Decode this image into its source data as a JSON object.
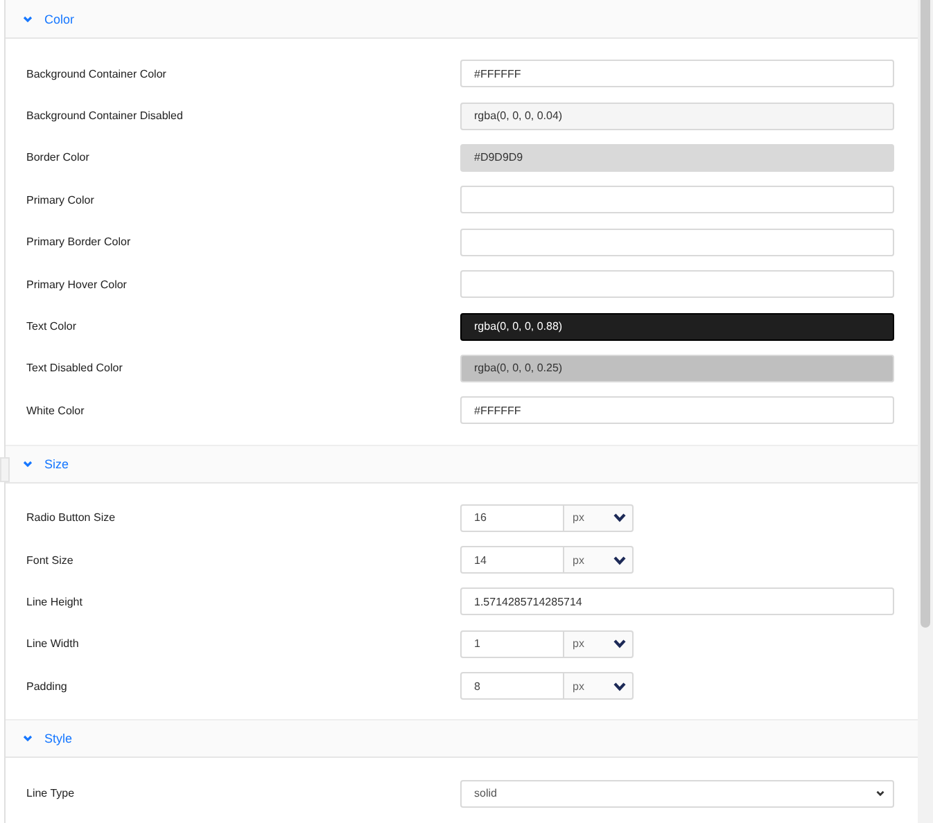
{
  "sections": [
    {
      "title": "Color",
      "expanded": true,
      "rows": [
        {
          "label": "Background Container Color",
          "kind": "color",
          "value": "#FFFFFF",
          "color": "#ffffff"
        },
        {
          "label": "Background Container Disabled",
          "kind": "color",
          "value": "rgba(0, 0, 0, 0.04)",
          "color": "#f5f5f5"
        },
        {
          "label": "Border Color",
          "kind": "color",
          "value": "#D9D9D9",
          "color": "#d9d9d9"
        },
        {
          "label": "Primary Color",
          "kind": "color",
          "color": "#ffffff"
        },
        {
          "label": "Primary Border Color",
          "kind": "color",
          "color": "#ffffff"
        },
        {
          "label": "Primary Hover Color",
          "kind": "color",
          "color": "#ffffff"
        },
        {
          "label": "Text Color",
          "kind": "color",
          "value": "rgba(0, 0, 0, 0.88)",
          "color": "#1f1f1f"
        },
        {
          "label": "Text Disabled Color",
          "kind": "color",
          "value": "rgba(0, 0, 0, 0.25)",
          "color": "#bfbfbf"
        },
        {
          "label": "White Color",
          "kind": "color",
          "value": "#FFFFFF",
          "color": "#ffffff"
        }
      ]
    },
    {
      "title": "Size",
      "expanded": true,
      "rows": [
        {
          "label": "Radio Button Size",
          "kind": "unit",
          "value": "16",
          "unit": "px"
        },
        {
          "label": "Font Size",
          "kind": "unit",
          "value": "14",
          "unit": "px"
        },
        {
          "label": "Line Height",
          "kind": "text",
          "value": "1.5714285714285714"
        },
        {
          "label": "Line Width",
          "kind": "unit",
          "value": "1",
          "unit": "px"
        },
        {
          "label": "Padding",
          "kind": "unit",
          "value": "8",
          "unit": "px"
        }
      ]
    },
    {
      "title": "Style",
      "expanded": true,
      "rows": [
        {
          "label": "Line Type",
          "kind": "select",
          "value": "solid"
        }
      ]
    }
  ]
}
